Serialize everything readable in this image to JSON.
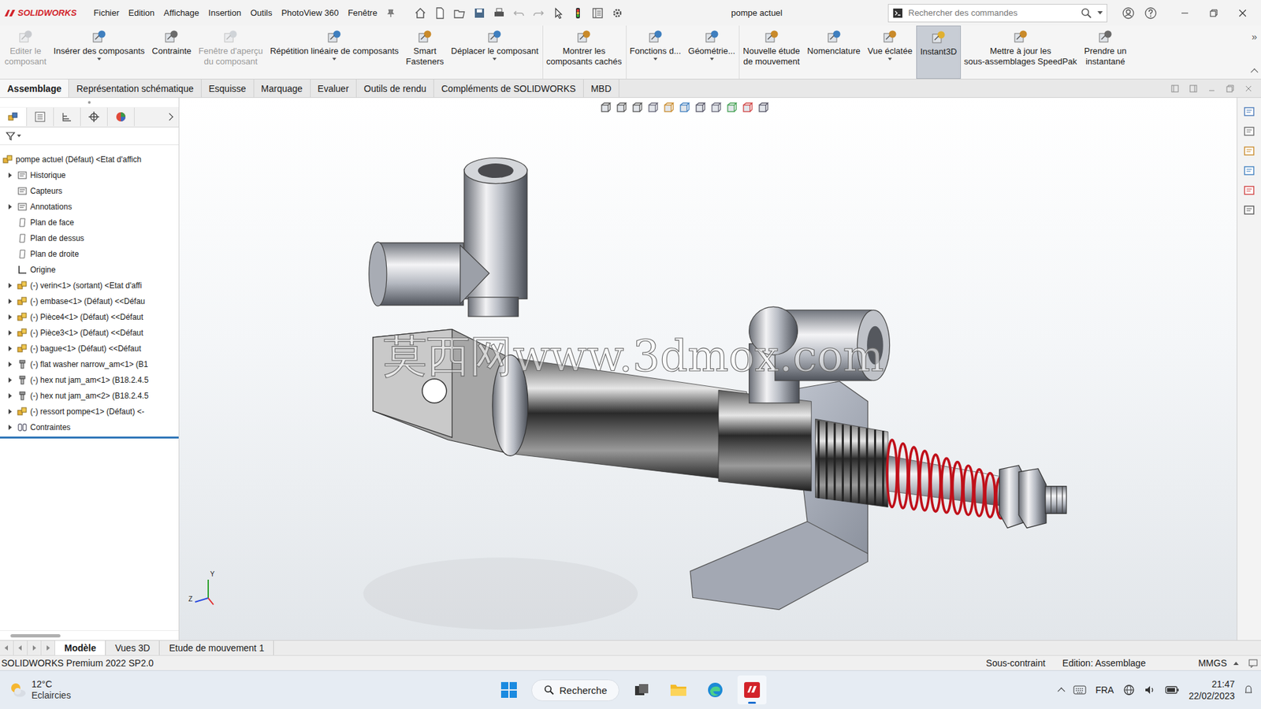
{
  "window": {
    "logo": "SOLIDWORKS",
    "title": "pompe actuel"
  },
  "menus": [
    "Fichier",
    "Edition",
    "Affichage",
    "Insertion",
    "Outils",
    "PhotoView 360",
    "Fenêtre"
  ],
  "search": {
    "placeholder": "Rechercher des commandes"
  },
  "ribbon": {
    "more": "»",
    "commands": [
      {
        "label": "Editer le\ncomposant",
        "disabled": true,
        "dropdown": false,
        "selected": false
      },
      {
        "label": "Insérer des composants",
        "disabled": false,
        "dropdown": true,
        "selected": false
      },
      {
        "label": "Contrainte",
        "disabled": false,
        "dropdown": false,
        "selected": false
      },
      {
        "label": "Fenêtre d'aperçu\ndu composant",
        "disabled": true,
        "dropdown": false,
        "selected": false
      },
      {
        "label": "Répétition linéaire de composants",
        "disabled": false,
        "dropdown": true,
        "selected": false
      },
      {
        "label": "Smart\nFasteners",
        "disabled": false,
        "dropdown": false,
        "selected": false
      },
      {
        "label": "Déplacer le composant",
        "disabled": false,
        "dropdown": true,
        "selected": false
      },
      {
        "label": "Montrer les\ncomposants cachés",
        "disabled": false,
        "dropdown": false,
        "selected": false
      },
      {
        "label": "Fonctions d...",
        "disabled": false,
        "dropdown": true,
        "selected": false
      },
      {
        "label": "Géométrie...",
        "disabled": false,
        "dropdown": true,
        "selected": false
      },
      {
        "label": "Nouvelle étude\nde mouvement",
        "disabled": false,
        "dropdown": false,
        "selected": false
      },
      {
        "label": "Nomenclature",
        "disabled": false,
        "dropdown": false,
        "selected": false
      },
      {
        "label": "Vue éclatée",
        "disabled": false,
        "dropdown": true,
        "selected": false
      },
      {
        "label": "Instant3D",
        "disabled": false,
        "dropdown": false,
        "selected": true
      },
      {
        "label": "Mettre à jour les\nsous-assemblages SpeedPak",
        "disabled": false,
        "dropdown": false,
        "selected": false
      },
      {
        "label": "Prendre un\ninstantané",
        "disabled": false,
        "dropdown": false,
        "selected": false
      }
    ]
  },
  "command_tabs": [
    {
      "label": "Assemblage",
      "selected": true
    },
    {
      "label": "Représentation schématique",
      "selected": false
    },
    {
      "label": "Esquisse",
      "selected": false
    },
    {
      "label": "Marquage",
      "selected": false
    },
    {
      "label": "Evaluer",
      "selected": false
    },
    {
      "label": "Outils de rendu",
      "selected": false
    },
    {
      "label": "Compléments de SOLIDWORKS",
      "selected": false
    },
    {
      "label": "MBD",
      "selected": false
    }
  ],
  "tree": {
    "root": "pompe actuel (Défaut) <Etat d'affich",
    "items": [
      {
        "label": "Historique",
        "kind": "folder",
        "expandable": true
      },
      {
        "label": "Capteurs",
        "kind": "folder",
        "expandable": false
      },
      {
        "label": "Annotations",
        "kind": "folder",
        "expandable": true
      },
      {
        "label": "Plan de face",
        "kind": "plane",
        "expandable": false
      },
      {
        "label": "Plan de dessus",
        "kind": "plane",
        "expandable": false
      },
      {
        "label": "Plan de droite",
        "kind": "plane",
        "expandable": false
      },
      {
        "label": "Origine",
        "kind": "origin",
        "expandable": false
      },
      {
        "label": "(-) verin<1> (sortant) <Etat d'affi",
        "kind": "part",
        "expandable": true
      },
      {
        "label": "(-) embase<1> (Défaut) <<Défau",
        "kind": "part",
        "expandable": true
      },
      {
        "label": "(-) Pièce4<1> (Défaut) <<Défaut",
        "kind": "part",
        "expandable": true
      },
      {
        "label": "(-) Pièce3<1> (Défaut) <<Défaut",
        "kind": "part",
        "expandable": true
      },
      {
        "label": "(-) bague<1> (Défaut) <<Défaut",
        "kind": "part",
        "expandable": true
      },
      {
        "label": "(-) flat washer narrow_am<1> (B1",
        "kind": "fastener",
        "expandable": true
      },
      {
        "label": "(-) hex nut jam_am<1> (B18.2.4.5",
        "kind": "fastener",
        "expandable": true
      },
      {
        "label": "(-) hex nut jam_am<2> (B18.2.4.5",
        "kind": "fastener",
        "expandable": true
      },
      {
        "label": "(-) ressort pompe<1> (Défaut) <-",
        "kind": "part",
        "expandable": true
      },
      {
        "label": "Contraintes",
        "kind": "mates",
        "expandable": true
      }
    ]
  },
  "viewport": {
    "watermark": "莫西网www.3dmox.com",
    "triad": [
      "Y",
      "Z"
    ]
  },
  "bottom_tabs": [
    {
      "label": "Modèle",
      "selected": true
    },
    {
      "label": "Vues 3D",
      "selected": false
    },
    {
      "label": "Etude de mouvement 1",
      "selected": false
    }
  ],
  "status_bar": {
    "product": "SOLIDWORKS Premium 2022 SP2.0",
    "items": [
      "Sous-contraint",
      "Edition: Assemblage",
      "MMGS"
    ]
  },
  "taskbar": {
    "weather": {
      "temp": "12°C",
      "text": "Eclaircies"
    },
    "search": "Recherche",
    "language": "FRA",
    "time": "21:47",
    "date": "22/02/2023"
  }
}
